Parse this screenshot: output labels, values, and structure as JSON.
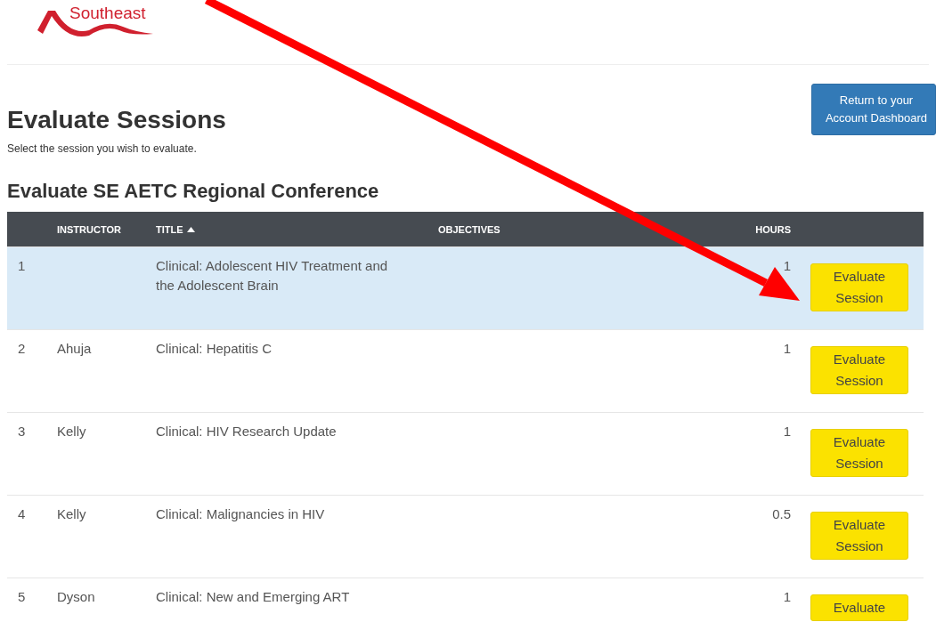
{
  "logo": {
    "text": "Southeast"
  },
  "header": {
    "title": "Evaluate Sessions",
    "subtitle": "Select the session you wish to evaluate.",
    "return_button": "Return to your Account Dashboard"
  },
  "section_title": "Evaluate SE AETC Regional Conference",
  "table": {
    "columns": [
      {
        "label": "INSTRUCTOR",
        "sorted": false
      },
      {
        "label": "TITLE",
        "sorted": true
      },
      {
        "label": "OBJECTIVES",
        "sorted": false
      },
      {
        "label": "HOURS",
        "sorted": false
      }
    ],
    "rows": [
      {
        "number": "1",
        "title": "Clinical: Adolescent HIV Treatment and the Adolescent Brain",
        "hours": "1",
        "button": "Evaluate Session",
        "selected": true
      },
      {
        "number": "2",
        "instructor": "Ahuja",
        "title": "Clinical: Hepatitis C",
        "hours": "1",
        "button": "Evaluate Session",
        "selected": false
      },
      {
        "number": "3",
        "instructor": "Kelly",
        "title": "Clinical: HIV Research Update",
        "hours": "1",
        "button": "Evaluate Session",
        "selected": false
      },
      {
        "number": "4",
        "instructor": "Kelly",
        "title": "Clinical: Malignancies in HIV",
        "hours": "0.5",
        "button": "Evaluate Session",
        "selected": false
      },
      {
        "number": "5",
        "instructor": "Dyson",
        "title": "Clinical: New and Emerging ART",
        "hours": "1",
        "button": "Evaluate",
        "selected": false
      }
    ]
  }
}
